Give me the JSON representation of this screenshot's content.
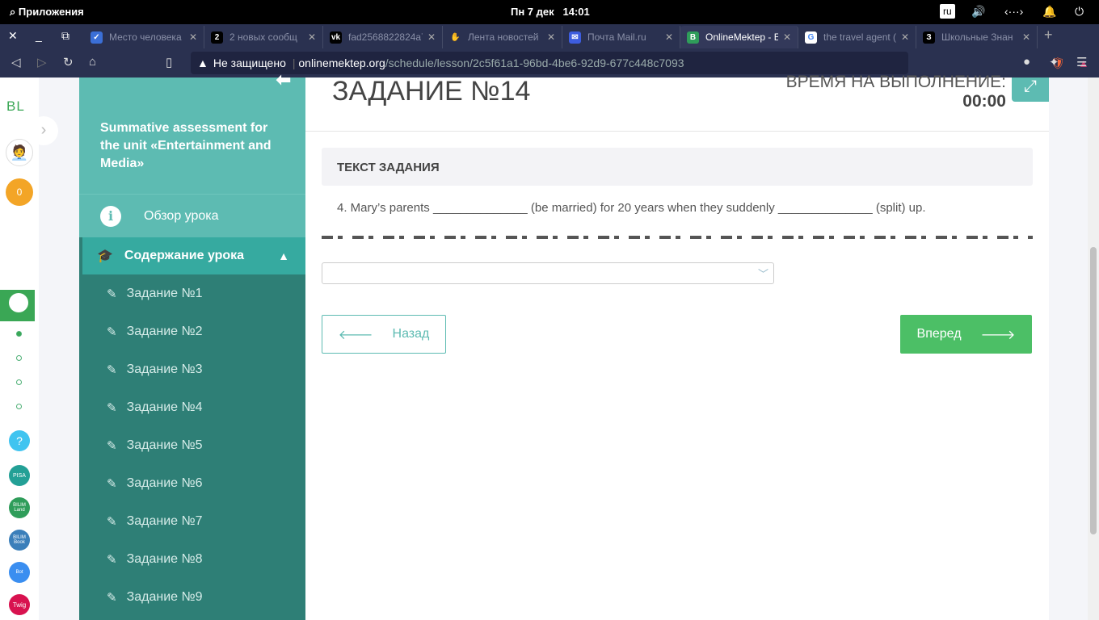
{
  "system": {
    "apps": "Приложения",
    "datetime": "Пн  7 дек",
    "time": "14:01",
    "lang": "ru"
  },
  "tabs": [
    {
      "title": "Место человека",
      "fav": "✓",
      "color": "#3b6fd6"
    },
    {
      "title": "2 новых сообщ",
      "fav": "2",
      "color": "#000"
    },
    {
      "title": "fad2568822824a7",
      "fav": "vk",
      "color": "#000"
    },
    {
      "title": "Лента новостей",
      "fav": "✋",
      "color": "#2a3150"
    },
    {
      "title": "Почта Mail.ru",
      "fav": "✉",
      "color": "#3d5ddf"
    },
    {
      "title": "OnlineMektep - E",
      "fav": "B",
      "color": "#2f9d5a"
    },
    {
      "title": "the travel agent (",
      "fav": "G",
      "color": "#fff"
    },
    {
      "title": "Школьные Знан",
      "fav": "З",
      "color": "#000"
    }
  ],
  "address": {
    "security": "Не защищено",
    "domain": "onlinemektep.org",
    "path": "/schedule/lesson/2c5f61a1-96bd-4be6-92d9-677c448c7093"
  },
  "leftbar": {
    "logo": "BL",
    "points": "0",
    "apps": [
      "?",
      "PISA",
      "BILIM Land",
      "BILIM Book",
      "Bot",
      "Twig"
    ]
  },
  "lesson": {
    "title": "Summative assessment for the unit «Entertainment and Media»",
    "overview": "Обзор урока",
    "content": "Содержание урока",
    "items": [
      "Задание №1",
      "Задание №2",
      "Задание №3",
      "Задание №4",
      "Задание №5",
      "Задание №6",
      "Задание №7",
      "Задание №8",
      "Задание №9"
    ]
  },
  "task": {
    "title": "ЗАДАНИЕ №14",
    "time_label": "ВРЕМЯ НА ВЫПОЛНЕНИЕ:",
    "time": "00:00",
    "header": "ТЕКСТ ЗАДАНИЯ",
    "question": "4. Mary’s parents ______________ (be married) for 20 years when they suddenly ______________ (split) up.",
    "select_value": "",
    "back": "Назад",
    "forward": "Вперед"
  }
}
